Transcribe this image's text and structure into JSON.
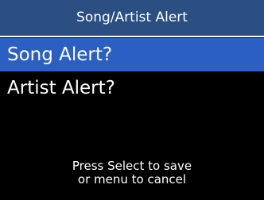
{
  "header": {
    "title": "Song/Artist Alert",
    "background_color": "#2b4e83"
  },
  "menu": {
    "selected_index": 0,
    "highlight_color": "#2c5fc3",
    "items": [
      {
        "label": "Song Alert?"
      },
      {
        "label": "Artist Alert?"
      }
    ]
  },
  "footer": {
    "line1": "Press Select to save",
    "line2": "or menu to cancel"
  }
}
